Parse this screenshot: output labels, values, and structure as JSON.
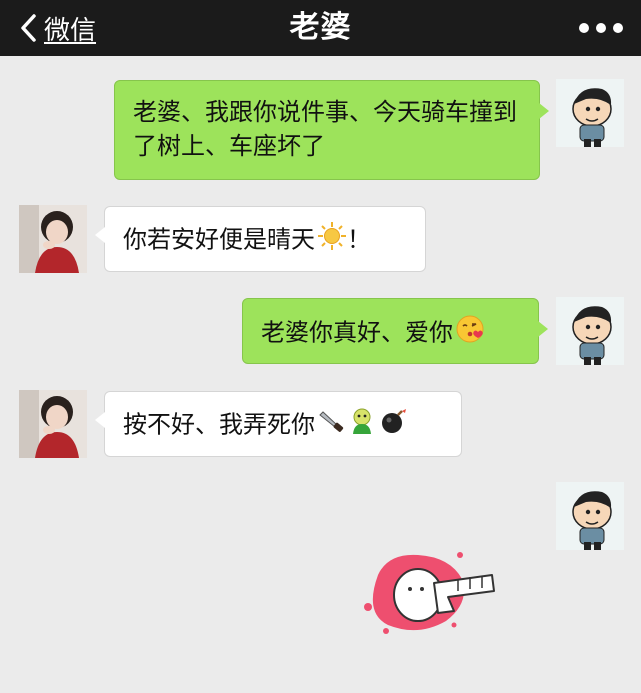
{
  "header": {
    "back_label": "微信",
    "title": "老婆"
  },
  "messages": [
    {
      "sender": "me",
      "text": "老婆、我跟你说件事、今天骑车撞到了树上、车座坏了"
    },
    {
      "sender": "other",
      "text": "你若安好便是晴天",
      "suffix": "！",
      "emojis": [
        "sun-emoji"
      ]
    },
    {
      "sender": "me",
      "text": "老婆你真好、爱你",
      "emojis": [
        "kiss-face-emoji"
      ]
    },
    {
      "sender": "other",
      "text": "按不好、我弄死你",
      "emojis": [
        "knife-emoji",
        "green-face-emoji",
        "bomb-emoji"
      ]
    },
    {
      "sender": "me",
      "type": "sticker",
      "sticker": "pushing-hand-sticker"
    }
  ],
  "colors": {
    "topbar": "#1b1b1b",
    "background": "#ebebeb",
    "my_bubble": "#9de35b",
    "other_bubble": "#ffffff"
  }
}
